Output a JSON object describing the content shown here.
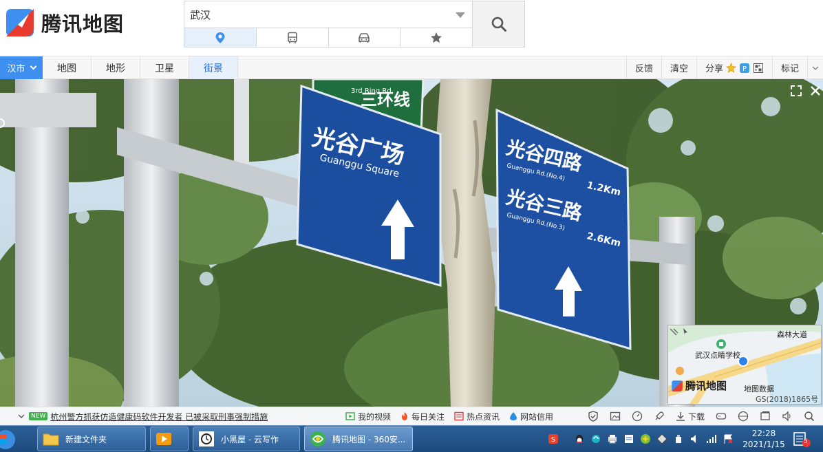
{
  "header": {
    "logo_text": "腾讯地图",
    "search_value": "武汉",
    "mode_tabs": [
      "place-icon",
      "bus-icon",
      "car-icon",
      "star-icon"
    ],
    "accent": "#3d8ff0"
  },
  "toolbar": {
    "city_label": "汉市",
    "layers": [
      "地图",
      "地形",
      "卫星",
      "街景"
    ],
    "active_layer": "街景",
    "tools": {
      "feedback": "反馈",
      "clear": "清空",
      "share": "分享",
      "mark": "标记"
    }
  },
  "streetview": {
    "signs": {
      "ring_road_cn": "三环线",
      "ring_road_en": "3rd Ring Rd.",
      "left_cn": "光谷广场",
      "left_en": "Guanggu Square",
      "right_line1_cn": "光谷四路",
      "right_line1_en": "Guanggu Rd.(No.4)",
      "right_line1_dist": "1.2Km",
      "right_line2_cn": "光谷三路",
      "right_line2_en": "Guanggu Rd.(No.3)",
      "right_line2_dist": "2.6Km"
    },
    "minimap": {
      "school": "武汉点睛学校",
      "road": "森林大道",
      "brand": "腾讯地图",
      "data_label": "地图数据",
      "copyright": "GS(2018)1865号"
    }
  },
  "newsbar": {
    "badge": "NEW",
    "headline": "杭州警方抓获仿造健康码软件开发者 已被采取刑事强制措施",
    "links": [
      "我的视频",
      "每日关注",
      "热点资讯",
      "网站信用"
    ],
    "download": "下载"
  },
  "taskbar": {
    "tasks": [
      "新建文件夹",
      "小黑屋 - 云写作",
      "腾讯地图 - 360安..."
    ],
    "time": "22:28",
    "date": "2021/1/15",
    "notif_count": "5"
  }
}
